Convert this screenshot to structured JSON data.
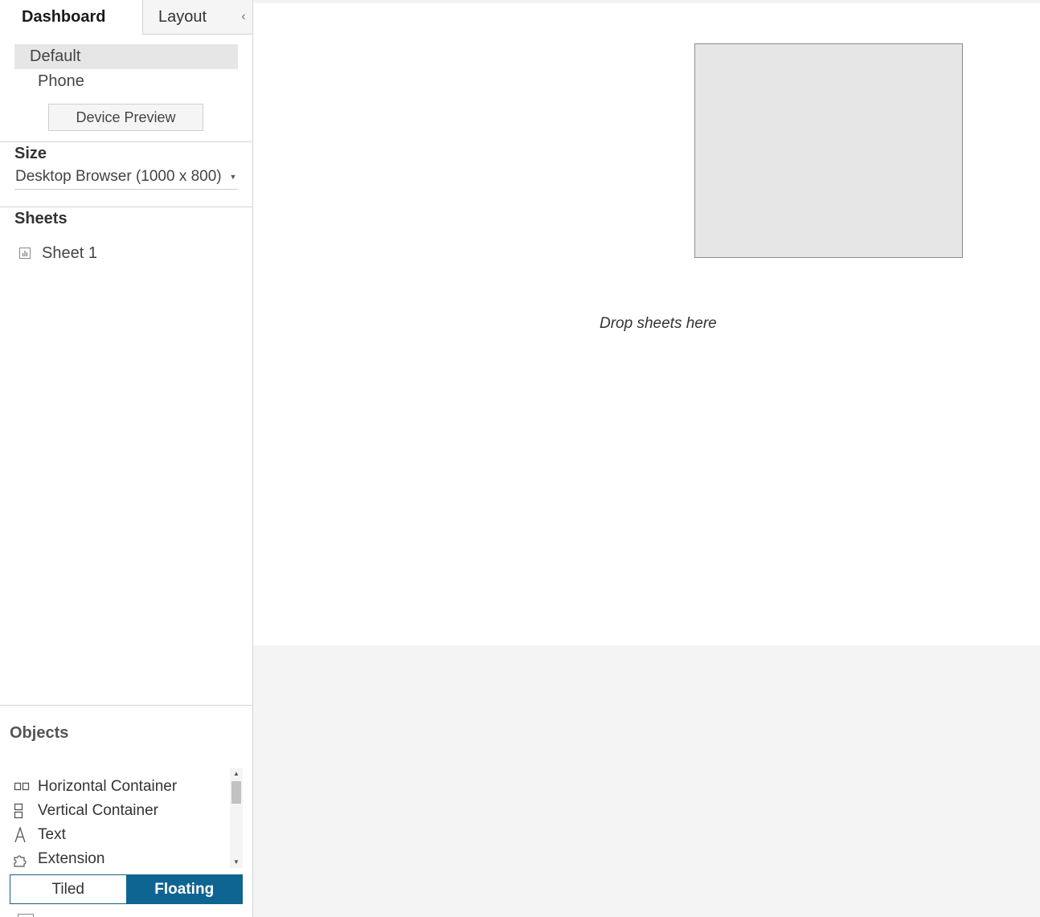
{
  "tabs": {
    "dashboard": "Dashboard",
    "layout": "Layout"
  },
  "collapse_icon": "chevron-left-icon",
  "device": {
    "options": [
      "Default",
      "Phone"
    ],
    "selected": "Default",
    "preview_button": "Device Preview"
  },
  "size": {
    "title": "Size",
    "value": "Desktop Browser (1000 x 800)"
  },
  "sheets": {
    "title": "Sheets",
    "items": [
      {
        "label": "Sheet 1",
        "icon": "worksheet-icon"
      }
    ]
  },
  "objects": {
    "title": "Objects",
    "items": [
      {
        "label": "Horizontal Container",
        "icon": "horizontal-container-icon"
      },
      {
        "label": "Vertical Container",
        "icon": "vertical-container-icon"
      },
      {
        "label": "Text",
        "icon": "text-icon"
      },
      {
        "label": "Extension",
        "icon": "extension-icon"
      }
    ]
  },
  "layout_mode": {
    "options": [
      "Tiled",
      "Floating"
    ],
    "selected": "Floating"
  },
  "canvas": {
    "drop_hint": "Drop sheets here"
  },
  "colors": {
    "accent": "#0f6591",
    "selected_bg": "#e6e6e6",
    "canvas_outer": "#f4f4f4"
  }
}
